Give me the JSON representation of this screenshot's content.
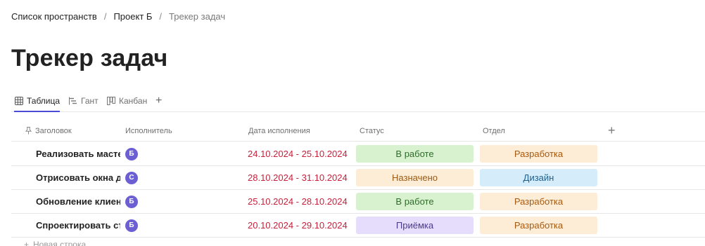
{
  "breadcrumb": {
    "items": [
      "Список пространств",
      "Проект Б"
    ],
    "current": "Трекер задач",
    "separator": "/"
  },
  "page": {
    "title": "Трекер задач"
  },
  "tabs": [
    {
      "label": "Таблица",
      "icon": "table-icon",
      "active": true
    },
    {
      "label": "Гант",
      "icon": "gantt-icon",
      "active": false
    },
    {
      "label": "Канбан",
      "icon": "kanban-icon",
      "active": false
    }
  ],
  "table": {
    "columns": {
      "title": "Заголовок",
      "assignee": "Исполнитель",
      "due": "Дата исполнения",
      "status": "Статус",
      "dept": "Отдел"
    },
    "rows": [
      {
        "title": "Реализовать мастер",
        "avatar": "Б",
        "due": "24.10.2024 - 25.10.2024",
        "status": "В работе",
        "dept": "Разработка"
      },
      {
        "title": "Отрисовать окна дл",
        "avatar": "С",
        "due": "28.10.2024 - 31.10.2024",
        "status": "Назначено",
        "dept": "Дизайн"
      },
      {
        "title": "Обновление клиент",
        "avatar": "Б",
        "due": "25.10.2024 - 28.10.2024",
        "status": "В работе",
        "dept": "Разработка"
      },
      {
        "title": "Спроектировать стр",
        "avatar": "Б",
        "due": "20.10.2024 - 29.10.2024",
        "status": "Приёмка",
        "dept": "Разработка"
      }
    ],
    "new_row_label": "Новая строка"
  },
  "colors": {
    "accent": "#4b4bd6",
    "avatar": "#6b5fd3",
    "due_date": "#c8203a",
    "status": {
      "В работе": {
        "bg": "#d8f2cf",
        "fg": "#2f6b2a"
      },
      "Назначено": {
        "bg": "#fdecd6",
        "fg": "#9a5a12"
      },
      "Приёмка": {
        "bg": "#e6dcfb",
        "fg": "#4b3a8c"
      }
    },
    "dept": {
      "Разработка": {
        "bg": "#fdecd6",
        "fg": "#a65a10"
      },
      "Дизайн": {
        "bg": "#d5ecfb",
        "fg": "#1f5f8a"
      }
    }
  }
}
